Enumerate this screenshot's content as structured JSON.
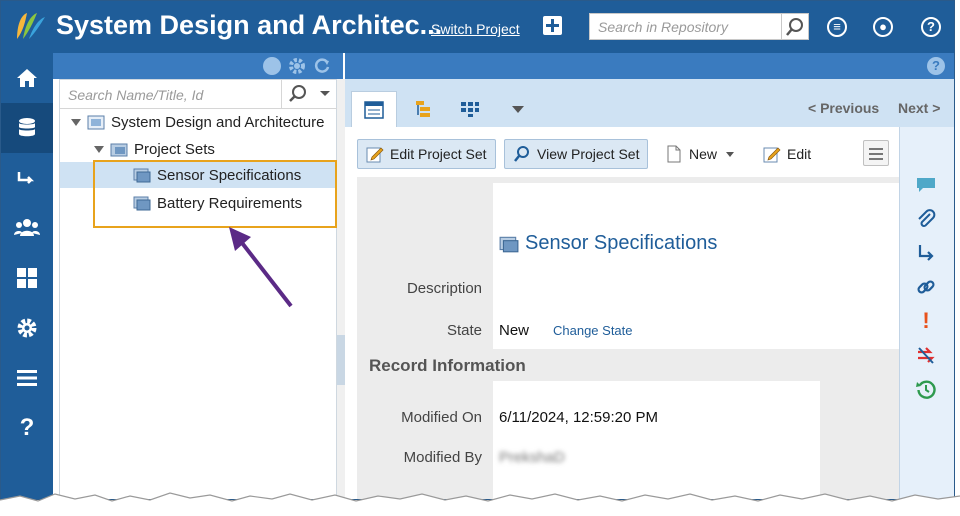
{
  "header": {
    "title": "System Design and Architec...",
    "switch_project": "Switch Project",
    "search_placeholder": "Search in Repository"
  },
  "tree": {
    "search_placeholder": "Search Name/Title, Id",
    "root": "System Design and Architecture",
    "folder": "Project Sets",
    "items": [
      {
        "label": "Sensor Specifications",
        "selected": true
      },
      {
        "label": "Battery Requirements",
        "selected": false
      }
    ]
  },
  "nav": {
    "previous": "< Previous",
    "next": "Next >"
  },
  "toolbar": {
    "edit_project_set": "Edit Project Set",
    "view_project_set": "View Project Set",
    "new": "New",
    "edit": "Edit"
  },
  "record": {
    "title": "Sensor Specifications",
    "description_label": "Description",
    "state_label": "State",
    "state_value": "New",
    "change_state": "Change State",
    "section": "Record Information",
    "modified_on_label": "Modified On",
    "modified_on_value": "6/11/2024, 12:59:20 PM",
    "modified_by_label": "Modified By",
    "modified_by_value": "PrekshaD"
  },
  "colors": {
    "header_blue": "#1f5d99",
    "selection": "#cfe2f3",
    "highlight_box": "#e8a31c",
    "arrow": "#5b2a86"
  }
}
